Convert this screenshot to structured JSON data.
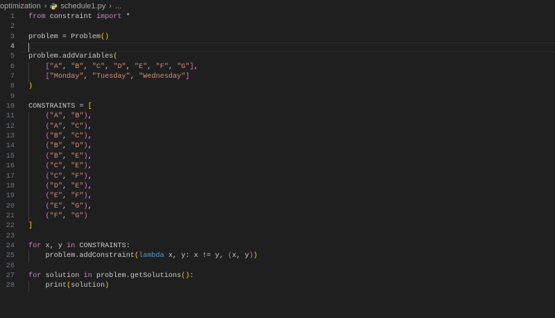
{
  "breadcrumb": {
    "folder": "optimization",
    "file": "schedule1.py",
    "more": "..."
  },
  "editor": {
    "current_line": 4,
    "lines": [
      {
        "n": "1",
        "tokens": [
          [
            "kw",
            "from"
          ],
          [
            "id",
            " constraint "
          ],
          [
            "kw",
            "import"
          ],
          [
            "op",
            " *"
          ]
        ]
      },
      {
        "n": "2",
        "tokens": []
      },
      {
        "n": "3",
        "tokens": [
          [
            "id",
            "problem = Problem"
          ],
          [
            "p1",
            "()"
          ]
        ]
      },
      {
        "n": "4",
        "tokens": []
      },
      {
        "n": "5",
        "tokens": [
          [
            "id",
            "problem.addVariables"
          ],
          [
            "p1",
            "("
          ]
        ]
      },
      {
        "n": "6",
        "tokens": [
          [
            "id",
            "    "
          ],
          [
            "p2",
            "["
          ],
          [
            "str",
            "\"A\""
          ],
          [
            "op",
            ", "
          ],
          [
            "str",
            "\"B\""
          ],
          [
            "op",
            ", "
          ],
          [
            "str",
            "\"C\""
          ],
          [
            "op",
            ", "
          ],
          [
            "str",
            "\"D\""
          ],
          [
            "op",
            ", "
          ],
          [
            "str",
            "\"E\""
          ],
          [
            "op",
            ", "
          ],
          [
            "str",
            "\"F\""
          ],
          [
            "op",
            ", "
          ],
          [
            "str",
            "\"G\""
          ],
          [
            "p2",
            "]"
          ],
          [
            "op",
            ","
          ]
        ]
      },
      {
        "n": "7",
        "tokens": [
          [
            "id",
            "    "
          ],
          [
            "p2",
            "["
          ],
          [
            "str",
            "\"Monday\""
          ],
          [
            "op",
            ", "
          ],
          [
            "str",
            "\"Tuesday\""
          ],
          [
            "op",
            ", "
          ],
          [
            "str",
            "\"Wednesday\""
          ],
          [
            "p2",
            "]"
          ]
        ]
      },
      {
        "n": "8",
        "tokens": [
          [
            "p1",
            ")"
          ]
        ]
      },
      {
        "n": "9",
        "tokens": []
      },
      {
        "n": "10",
        "tokens": [
          [
            "id",
            "CONSTRAINTS = "
          ],
          [
            "p1",
            "["
          ]
        ]
      },
      {
        "n": "11",
        "tokens": [
          [
            "id",
            "    "
          ],
          [
            "p2",
            "("
          ],
          [
            "str",
            "\"A\""
          ],
          [
            "op",
            ", "
          ],
          [
            "str",
            "\"B\""
          ],
          [
            "p2",
            ")"
          ],
          [
            "op",
            ","
          ]
        ]
      },
      {
        "n": "12",
        "tokens": [
          [
            "id",
            "    "
          ],
          [
            "p2",
            "("
          ],
          [
            "str",
            "\"A\""
          ],
          [
            "op",
            ", "
          ],
          [
            "str",
            "\"C\""
          ],
          [
            "p2",
            ")"
          ],
          [
            "op",
            ","
          ]
        ]
      },
      {
        "n": "13",
        "tokens": [
          [
            "id",
            "    "
          ],
          [
            "p2",
            "("
          ],
          [
            "str",
            "\"B\""
          ],
          [
            "op",
            ", "
          ],
          [
            "str",
            "\"C\""
          ],
          [
            "p2",
            ")"
          ],
          [
            "op",
            ","
          ]
        ]
      },
      {
        "n": "14",
        "tokens": [
          [
            "id",
            "    "
          ],
          [
            "p2",
            "("
          ],
          [
            "str",
            "\"B\""
          ],
          [
            "op",
            ", "
          ],
          [
            "str",
            "\"D\""
          ],
          [
            "p2",
            ")"
          ],
          [
            "op",
            ","
          ]
        ]
      },
      {
        "n": "15",
        "tokens": [
          [
            "id",
            "    "
          ],
          [
            "p2",
            "("
          ],
          [
            "str",
            "\"B\""
          ],
          [
            "op",
            ", "
          ],
          [
            "str",
            "\"E\""
          ],
          [
            "p2",
            ")"
          ],
          [
            "op",
            ","
          ]
        ]
      },
      {
        "n": "16",
        "tokens": [
          [
            "id",
            "    "
          ],
          [
            "p2",
            "("
          ],
          [
            "str",
            "\"C\""
          ],
          [
            "op",
            ", "
          ],
          [
            "str",
            "\"E\""
          ],
          [
            "p2",
            ")"
          ],
          [
            "op",
            ","
          ]
        ]
      },
      {
        "n": "17",
        "tokens": [
          [
            "id",
            "    "
          ],
          [
            "p2",
            "("
          ],
          [
            "str",
            "\"C\""
          ],
          [
            "op",
            ", "
          ],
          [
            "str",
            "\"F\""
          ],
          [
            "p2",
            ")"
          ],
          [
            "op",
            ","
          ]
        ]
      },
      {
        "n": "18",
        "tokens": [
          [
            "id",
            "    "
          ],
          [
            "p2",
            "("
          ],
          [
            "str",
            "\"D\""
          ],
          [
            "op",
            ", "
          ],
          [
            "str",
            "\"E\""
          ],
          [
            "p2",
            ")"
          ],
          [
            "op",
            ","
          ]
        ]
      },
      {
        "n": "19",
        "tokens": [
          [
            "id",
            "    "
          ],
          [
            "p2",
            "("
          ],
          [
            "str",
            "\"E\""
          ],
          [
            "op",
            ", "
          ],
          [
            "str",
            "\"F\""
          ],
          [
            "p2",
            ")"
          ],
          [
            "op",
            ","
          ]
        ]
      },
      {
        "n": "20",
        "tokens": [
          [
            "id",
            "    "
          ],
          [
            "p2",
            "("
          ],
          [
            "str",
            "\"E\""
          ],
          [
            "op",
            ", "
          ],
          [
            "str",
            "\"G\""
          ],
          [
            "p2",
            ")"
          ],
          [
            "op",
            ","
          ]
        ]
      },
      {
        "n": "21",
        "tokens": [
          [
            "id",
            "    "
          ],
          [
            "p2",
            "("
          ],
          [
            "str",
            "\"F\""
          ],
          [
            "op",
            ", "
          ],
          [
            "str",
            "\"G\""
          ],
          [
            "p2",
            ")"
          ]
        ]
      },
      {
        "n": "22",
        "tokens": [
          [
            "p1",
            "]"
          ]
        ]
      },
      {
        "n": "23",
        "tokens": []
      },
      {
        "n": "24",
        "tokens": [
          [
            "kw",
            "for"
          ],
          [
            "id",
            " x, y "
          ],
          [
            "kw",
            "in"
          ],
          [
            "id",
            " CONSTRAINTS:"
          ]
        ]
      },
      {
        "n": "25",
        "tokens": [
          [
            "id",
            "    problem.addConstraint"
          ],
          [
            "p1",
            "("
          ],
          [
            "bl",
            "lambda"
          ],
          [
            "id",
            " x, y: x != y, "
          ],
          [
            "p2",
            "("
          ],
          [
            "id",
            "x, y"
          ],
          [
            "p2",
            ")"
          ],
          [
            "p1",
            ")"
          ]
        ]
      },
      {
        "n": "26",
        "tokens": []
      },
      {
        "n": "27",
        "tokens": [
          [
            "kw",
            "for"
          ],
          [
            "id",
            " solution "
          ],
          [
            "kw",
            "in"
          ],
          [
            "id",
            " problem.getSolutions"
          ],
          [
            "p1",
            "()"
          ],
          [
            "id",
            ":"
          ]
        ]
      },
      {
        "n": "28",
        "tokens": [
          [
            "id",
            "    print"
          ],
          [
            "p1",
            "("
          ],
          [
            "id",
            "solution"
          ],
          [
            "p1",
            ")"
          ]
        ]
      }
    ]
  }
}
